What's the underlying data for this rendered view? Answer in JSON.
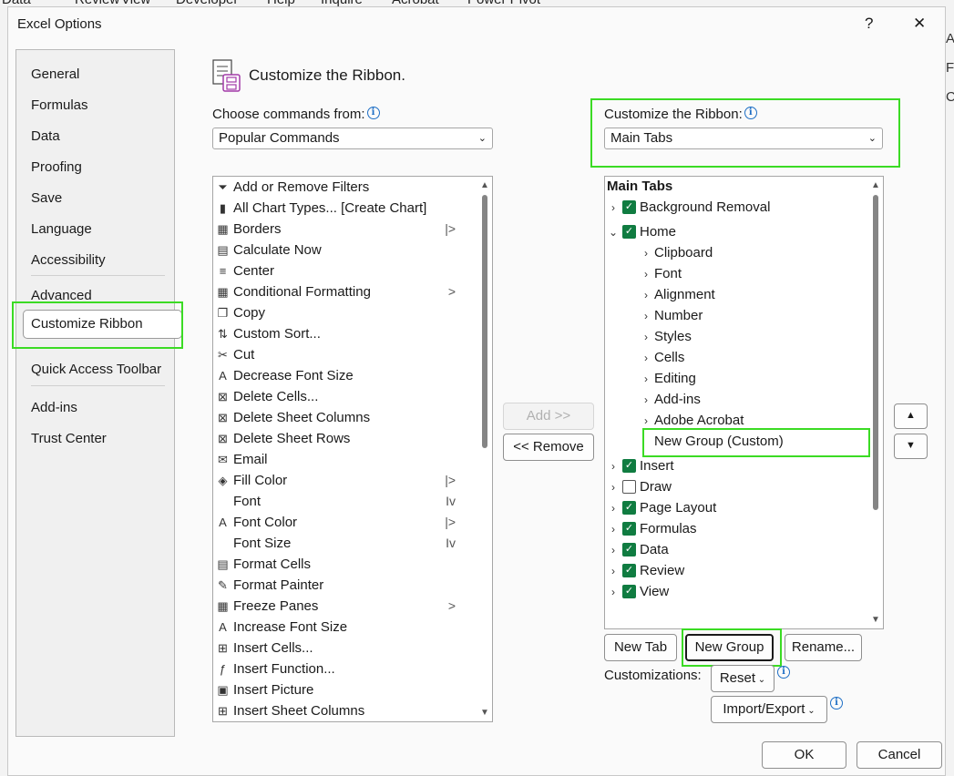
{
  "background_menu": [
    "Data",
    "Review",
    "View",
    "Developer",
    "Help",
    "Inquire",
    "Acrobat",
    "Power Pivot"
  ],
  "background_right": [
    "A",
    "F",
    "C"
  ],
  "dialog": {
    "title": "Excel Options",
    "help": "?",
    "close": "✕"
  },
  "nav": {
    "items": [
      "General",
      "Formulas",
      "Data",
      "Proofing",
      "Save",
      "Language",
      "Accessibility",
      "Advanced",
      "Customize Ribbon",
      "Quick Access Toolbar",
      "Add-ins",
      "Trust Center"
    ],
    "selected": "Customize Ribbon"
  },
  "heading": "Customize the Ribbon.",
  "left": {
    "label": "Choose commands from:",
    "select_value": "Popular Commands",
    "commands": [
      {
        "label": "Add or Remove Filters",
        "icon": "filter-icon",
        "glyph": "⏷"
      },
      {
        "label": "All Chart Types... [Create Chart]",
        "icon": "chart-icon",
        "glyph": "▮"
      },
      {
        "label": "Borders",
        "icon": "borders-icon",
        "glyph": "▦",
        "sub": "|>"
      },
      {
        "label": "Calculate Now",
        "icon": "calculator-icon",
        "glyph": "▤"
      },
      {
        "label": "Center",
        "icon": "align-center-icon",
        "glyph": "≡"
      },
      {
        "label": "Conditional Formatting",
        "icon": "conditional-formatting-icon",
        "glyph": "▦",
        "sub": ">"
      },
      {
        "label": "Copy",
        "icon": "copy-icon",
        "glyph": "❐"
      },
      {
        "label": "Custom Sort...",
        "icon": "sort-icon",
        "glyph": "⇅"
      },
      {
        "label": "Cut",
        "icon": "cut-icon",
        "glyph": "✂"
      },
      {
        "label": "Decrease Font Size",
        "icon": "decrease-font-icon",
        "glyph": "A"
      },
      {
        "label": "Delete Cells...",
        "icon": "delete-cells-icon",
        "glyph": "⊠"
      },
      {
        "label": "Delete Sheet Columns",
        "icon": "delete-columns-icon",
        "glyph": "⊠"
      },
      {
        "label": "Delete Sheet Rows",
        "icon": "delete-rows-icon",
        "glyph": "⊠"
      },
      {
        "label": "Email",
        "icon": "email-icon",
        "glyph": "✉"
      },
      {
        "label": "Fill Color",
        "icon": "fill-color-icon",
        "glyph": "◈",
        "sub": "|>"
      },
      {
        "label": "Font",
        "icon": "none",
        "glyph": "",
        "sub": "Iv"
      },
      {
        "label": "Font Color",
        "icon": "font-color-icon",
        "glyph": "A",
        "sub": "|>"
      },
      {
        "label": "Font Size",
        "icon": "none",
        "glyph": "",
        "sub": "Iv"
      },
      {
        "label": "Format Cells",
        "icon": "format-cells-icon",
        "glyph": "▤"
      },
      {
        "label": "Format Painter",
        "icon": "format-painter-icon",
        "glyph": "✎"
      },
      {
        "label": "Freeze Panes",
        "icon": "freeze-panes-icon",
        "glyph": "▦",
        "sub": ">"
      },
      {
        "label": "Increase Font Size",
        "icon": "increase-font-icon",
        "glyph": "A"
      },
      {
        "label": "Insert Cells...",
        "icon": "insert-cells-icon",
        "glyph": "⊞"
      },
      {
        "label": "Insert Function...",
        "icon": "function-icon",
        "glyph": "ƒ"
      },
      {
        "label": "Insert Picture",
        "icon": "picture-icon",
        "glyph": "▣"
      },
      {
        "label": "Insert Sheet Columns",
        "icon": "insert-columns-icon",
        "glyph": "⊞"
      }
    ]
  },
  "middle": {
    "add": "Add >>",
    "remove": "<< Remove"
  },
  "right": {
    "label": "Customize the Ribbon:",
    "select_value": "Main Tabs",
    "tree_header": "Main Tabs",
    "tree": [
      {
        "label": "Background Removal",
        "level": 0,
        "chevron": "›",
        "checked": true
      },
      {
        "label": "Home",
        "level": 0,
        "chevron": "⌄",
        "checked": true
      },
      {
        "label": "Clipboard",
        "level": 1,
        "chevron": "›"
      },
      {
        "label": "Font",
        "level": 1,
        "chevron": "›"
      },
      {
        "label": "Alignment",
        "level": 1,
        "chevron": "›"
      },
      {
        "label": "Number",
        "level": 1,
        "chevron": "›"
      },
      {
        "label": "Styles",
        "level": 1,
        "chevron": "›"
      },
      {
        "label": "Cells",
        "level": 1,
        "chevron": "›"
      },
      {
        "label": "Editing",
        "level": 1,
        "chevron": "›"
      },
      {
        "label": "Add-ins",
        "level": 1,
        "chevron": "›"
      },
      {
        "label": "Adobe Acrobat",
        "level": 1,
        "chevron": "›"
      },
      {
        "label": "New Group (Custom)",
        "level": 1,
        "chevron": "",
        "selected": true
      },
      {
        "label": "Insert",
        "level": 0,
        "chevron": "›",
        "checked": true
      },
      {
        "label": "Draw",
        "level": 0,
        "chevron": "›",
        "checked": false
      },
      {
        "label": "Page Layout",
        "level": 0,
        "chevron": "›",
        "checked": true
      },
      {
        "label": "Formulas",
        "level": 0,
        "chevron": "›",
        "checked": true
      },
      {
        "label": "Data",
        "level": 0,
        "chevron": "›",
        "checked": true
      },
      {
        "label": "Review",
        "level": 0,
        "chevron": "›",
        "checked": true
      },
      {
        "label": "View",
        "level": 0,
        "chevron": "›",
        "checked": true
      }
    ],
    "new_tab": "New Tab",
    "new_group": "New Group",
    "rename": "Rename...",
    "customizations_label": "Customizations:",
    "reset": "Reset",
    "import_export": "Import/Export"
  },
  "footer": {
    "ok": "OK",
    "cancel": "Cancel"
  }
}
